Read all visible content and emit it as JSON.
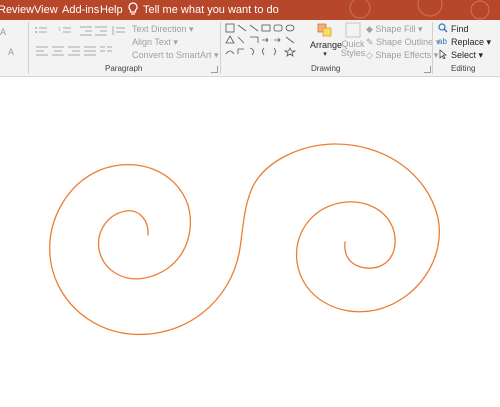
{
  "menu": {
    "items": [
      "Review",
      "View",
      "Add-ins",
      "Help"
    ],
    "tell_me": "Tell me what you want to do"
  },
  "ribbon": {
    "paragraph": {
      "label": "Paragraph",
      "text_direction": "Text Direction",
      "align_text": "Align Text",
      "convert_smartart": "Convert to SmartArt"
    },
    "drawing": {
      "label": "Drawing",
      "arrange": "Arrange",
      "quick_styles": "Quick Styles",
      "shape_fill": "Shape Fill",
      "shape_outline": "Shape Outline",
      "shape_effects": "Shape Effects"
    },
    "editing": {
      "label": "Editing",
      "find": "Find",
      "replace": "Replace",
      "select": "Select"
    }
  },
  "colors": {
    "menubar": "#b7472a",
    "spiral_stroke": "#ed7d31"
  },
  "canvas": {
    "shape": "double-spiral-curve"
  }
}
